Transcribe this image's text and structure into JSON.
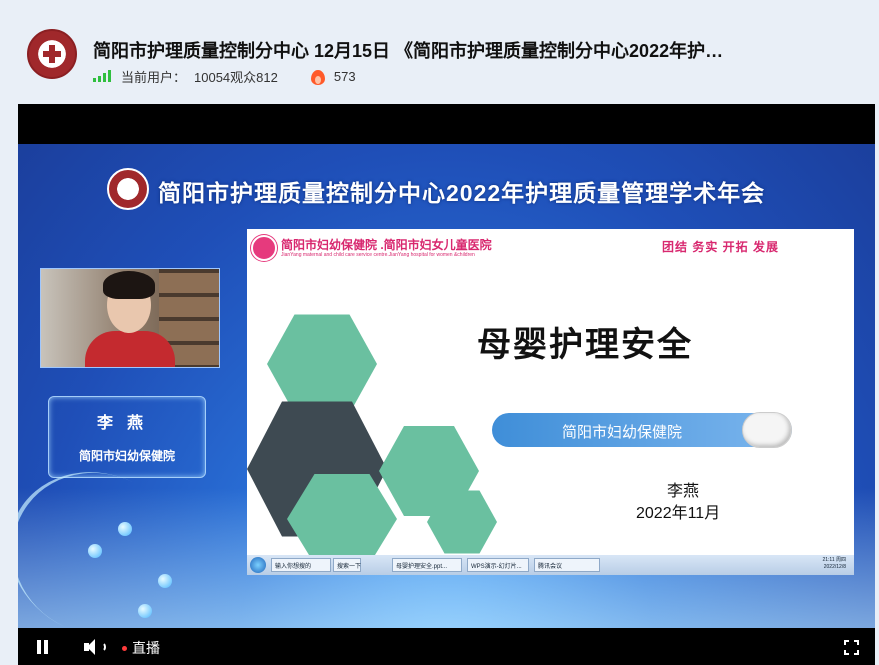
{
  "header": {
    "title": "简阳市护理质量控制分中心 12月15日 《简阳市护理质量控制分中心2022年护…",
    "current_users_label": "当前用户：",
    "viewer_stats": "10054观众812",
    "likes": "573"
  },
  "video": {
    "conference_title": "简阳市护理质量控制分中心2022年护理质量管理学术年会",
    "namecard": {
      "name": "李燕",
      "org": "简阳市妇幼保健院"
    },
    "slide": {
      "hospital_name": "简阳市妇幼保健院 .简阳市妇女儿童医院",
      "hospital_name_en": "JianYang maternal and child care service centre.JianYang hospital for women &children",
      "motto": "团结  务实  开拓  发展",
      "title": "母婴护理安全",
      "pill_text": "简阳市妇幼保健院",
      "presenter": "李燕",
      "date": "2022年11月"
    },
    "taskbar": {
      "search_placeholder": "输入你想搜的",
      "search_button": "搜索一下",
      "items": [
        "母婴护理安全.ppt...",
        "WPS演示-幻灯片...",
        "腾讯会议"
      ],
      "time": "21:11 周四",
      "date": "2022/12/8"
    }
  },
  "controls": {
    "live_label": "直播"
  },
  "colors": {
    "accent_green": "#2fbf3f",
    "fire": "#ff5a2a",
    "live_dot": "#ff3b3b",
    "slide_pink": "#d8286f",
    "hexagon_teal": "#6ac0a0"
  }
}
